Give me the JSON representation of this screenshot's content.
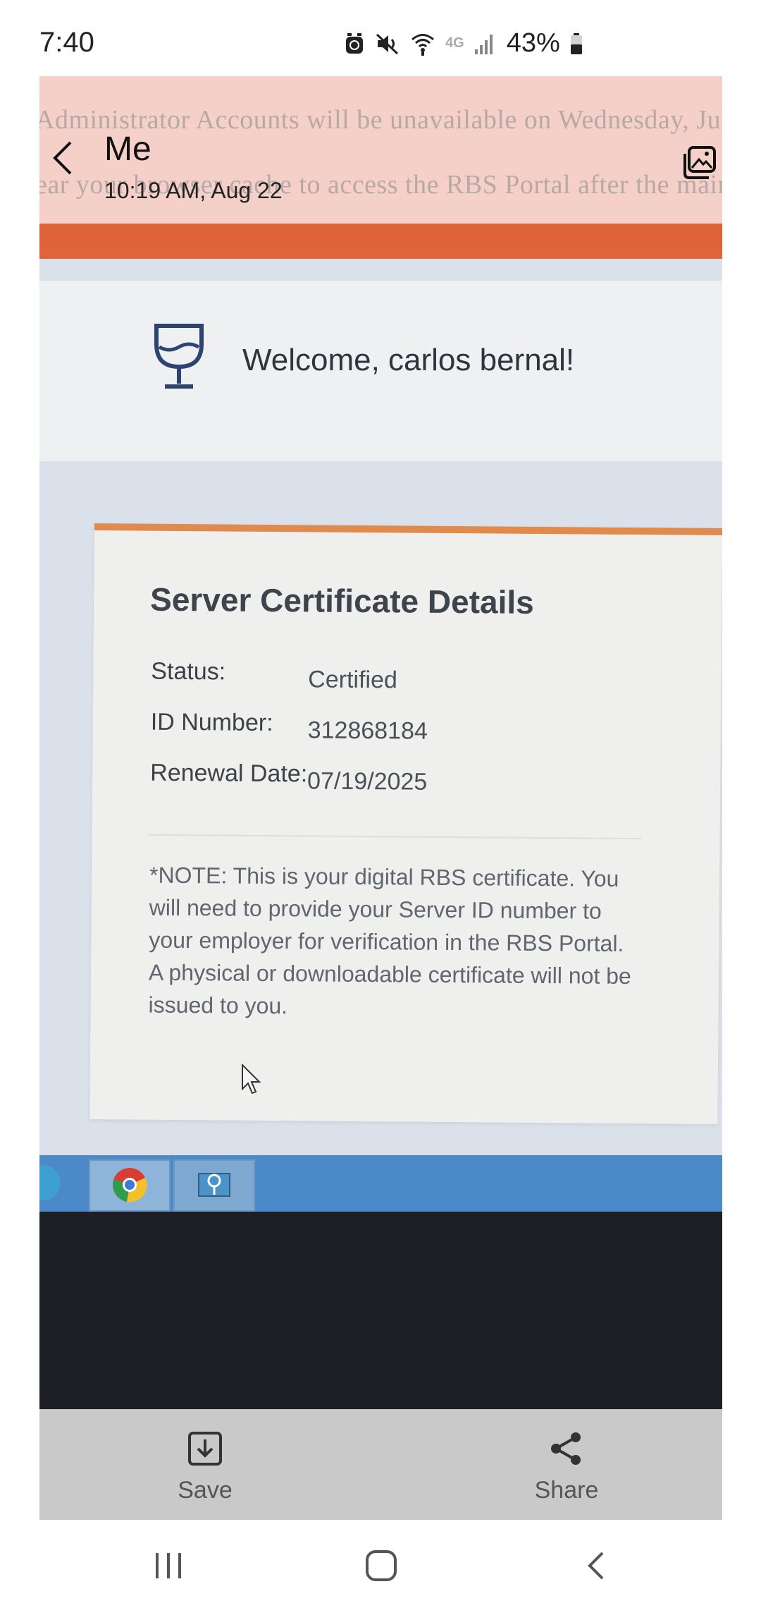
{
  "status_bar": {
    "time": "7:40",
    "network": "4G",
    "battery": "43%"
  },
  "viewer": {
    "sender": "Me",
    "timestamp": "10:19 AM, Aug 22"
  },
  "photo": {
    "banner_line_1": "Administrator Accounts will be unavailable on Wednesday, Jul",
    "banner_line_2": "ear your browser cache to access the RBS Portal after the main",
    "welcome_text": "Welcome, carlos bernal!",
    "card": {
      "title": "Server Certificate Details",
      "rows": [
        {
          "label": "Status:",
          "value": "Certified"
        },
        {
          "label": "ID Number:",
          "value": "312868184"
        },
        {
          "label": "Renewal Date:",
          "value": "07/19/2025"
        }
      ],
      "note": "*NOTE: This is your digital RBS certificate. You will need to provide your Server ID number to your employer for verification in the RBS Portal. A physical or downloadable certificate will not be issued to you."
    }
  },
  "actions": {
    "save_label": "Save",
    "share_label": "Share"
  },
  "colors": {
    "banner": "#f4d0c8",
    "accent_orange": "#e0643a",
    "card_border": "#e08a4e",
    "taskbar": "#4b89c8",
    "action_bar": "#c9c9c9"
  }
}
